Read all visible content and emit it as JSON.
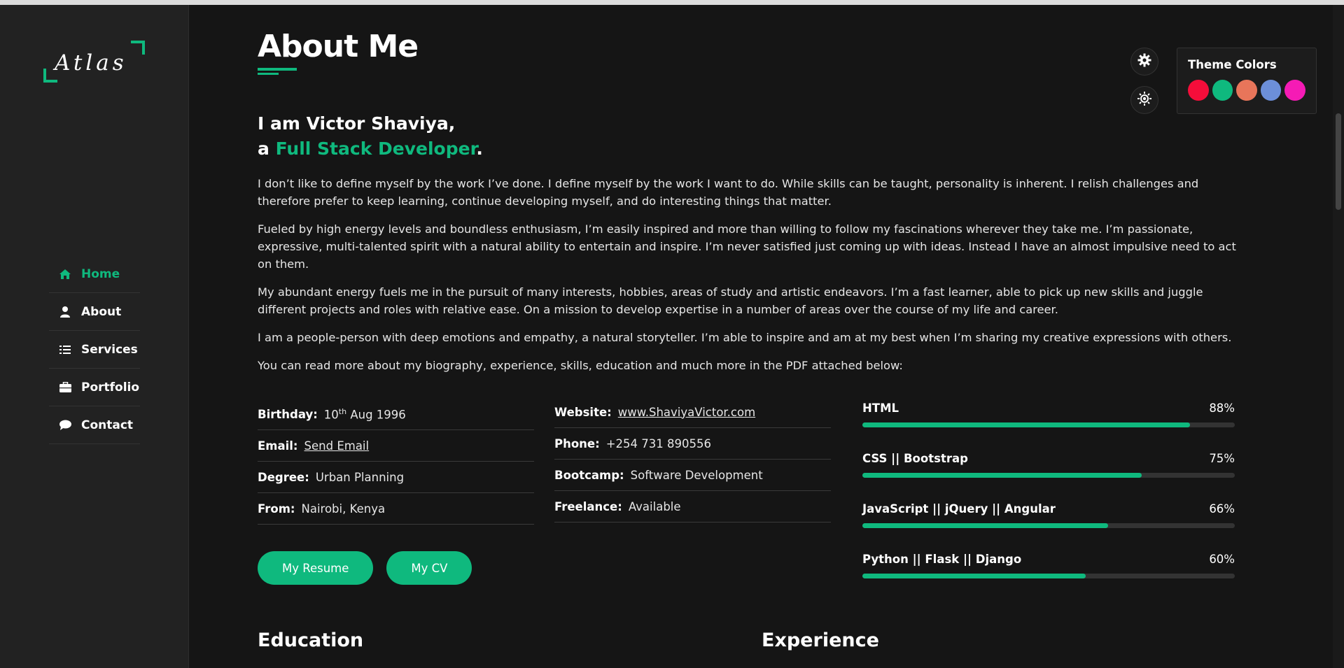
{
  "logo": {
    "text": "Atlas"
  },
  "nav": {
    "items": [
      {
        "label": "Home",
        "icon": "home-icon",
        "active": true
      },
      {
        "label": "About",
        "icon": "user-icon"
      },
      {
        "label": "Services",
        "icon": "list-icon"
      },
      {
        "label": "Portfolio",
        "icon": "briefcase-icon"
      },
      {
        "label": "Contact",
        "icon": "comment-icon"
      }
    ]
  },
  "page": {
    "title": "About Me",
    "intro_line1": "I am Victor Shaviya,",
    "intro_prefix": "a ",
    "intro_role": "Full Stack Developer",
    "intro_suffix": ".",
    "bio": [
      "I don’t like to define myself by the work I’ve done. I define myself by the work I want to do. While skills can be taught, personality is inherent. I relish challenges and therefore prefer to keep learning, continue developing myself, and do interesting things that matter.",
      "Fueled by high energy levels and boundless enthusiasm, I’m easily inspired and more than willing to follow my fascinations wherever they take me. I’m passionate, expressive, multi-talented spirit with a natural ability to entertain and inspire. I’m never satisfied just coming up with ideas. Instead I have an almost impulsive need to act on them.",
      "My abundant energy fuels me in the pursuit of many interests, hobbies, areas of study and artistic endeavors. I’m a fast learner, able to pick up new skills and juggle different projects and roles with relative ease. On a mission to develop expertise in a number of areas over the course of my life and career.",
      "I am a people-person with deep emotions and empathy, a natural storyteller. I’m able to inspire and am at my best when I’m sharing my creative expressions with others.",
      "You can read more about my biography, experience, skills, education and much more in the PDF attached below:"
    ]
  },
  "info": {
    "birthday_label": "Birthday:",
    "birthday_day": "10",
    "birthday_sup": "th",
    "birthday_rest": " Aug 1996",
    "email_label": "Email:",
    "email_value": "Send Email",
    "degree_label": "Degree:",
    "degree_value": "Urban Planning",
    "from_label": "From:",
    "from_value": "Nairobi, Kenya",
    "website_label": "Website:",
    "website_value": "www.ShaviyaVictor.com",
    "phone_label": "Phone:",
    "phone_value": "+254 731 890556",
    "bootcamp_label": "Bootcamp:",
    "bootcamp_value": "Software Development",
    "freelance_label": "Freelance:",
    "freelance_value": "Available"
  },
  "buttons": {
    "resume": "My Resume",
    "cv": "My CV"
  },
  "skills": [
    {
      "name": "HTML",
      "percent_label": "88%",
      "value": 88
    },
    {
      "name": "CSS || Bootstrap",
      "percent_label": "75%",
      "value": 75
    },
    {
      "name": "JavaScript || jQuery || Angular",
      "percent_label": "66%",
      "value": 66
    },
    {
      "name": "Python || Flask || Django",
      "percent_label": "60%",
      "value": 60
    }
  ],
  "sections": {
    "education": "Education",
    "experience": "Experience"
  },
  "theme": {
    "title": "Theme Colors",
    "colors": [
      "#f50d3a",
      "#0fb97e",
      "#e8755a",
      "#6c8fd9",
      "#f51bb5"
    ],
    "accent": "#0fb97e"
  }
}
